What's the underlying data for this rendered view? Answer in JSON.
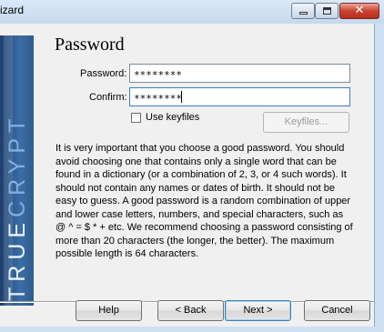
{
  "window": {
    "title": "izard",
    "minimize_glyph": "",
    "maximize_glyph": "",
    "close_glyph": "✕"
  },
  "banner": {
    "text_part1": "TRUE",
    "text_part2": "CRYPT"
  },
  "page": {
    "title": "Password"
  },
  "form": {
    "password_label": "Password:",
    "password_value": "********",
    "confirm_label": "Confirm:",
    "confirm_value": "********",
    "use_keyfiles_label": "Use keyfiles",
    "use_keyfiles_checked": false,
    "keyfiles_button": "Keyfiles..."
  },
  "info_text": "It is very important that you choose a good password. You should avoid choosing one that contains only a single word that can be found in a dictionary (or a combination of 2, 3, or 4 such words). It should not contain any names or dates of birth. It should not be easy to guess. A good password is a random combination of upper and lower case letters, numbers, and special characters, such as @ ^ = $ * + etc. We recommend choosing a password consisting of more than 20 characters (the longer, the better). The maximum possible length is 64 characters.",
  "buttons": {
    "help": "Help",
    "back": "< Back",
    "next": "Next >",
    "cancel": "Cancel"
  },
  "colors": {
    "banner": "#2f5b8c",
    "banner_text": "#eaf2fb",
    "banner_accent": "#7fb0e2",
    "close_button": "#c8442f"
  }
}
